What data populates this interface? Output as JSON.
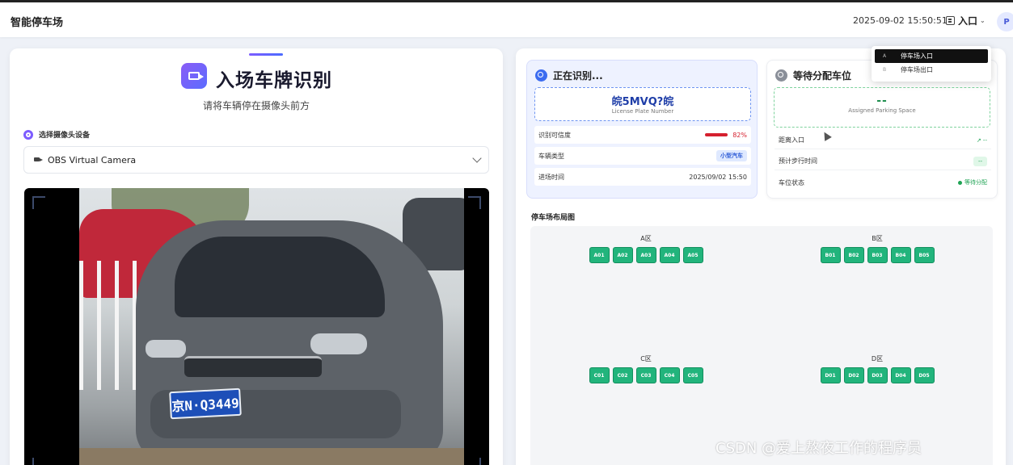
{
  "topbar": {
    "app_title": "智能停车场",
    "clock": "2025-09-02 15:50:51",
    "entry_label": "入口",
    "avatar_letter": "P"
  },
  "dropdown": {
    "items": [
      {
        "key": "A",
        "label": "停车场入口",
        "active": true
      },
      {
        "key": "B",
        "label": "停车场出口",
        "active": false
      }
    ]
  },
  "left": {
    "title": "入场车牌识别",
    "subtitle": "请将车辆停在摄像头前方",
    "camera_label": "选择摄像头设备",
    "camera_selected": "OBS Virtual Camera",
    "plate_in_video": "京N·Q3449"
  },
  "recognition": {
    "title": "正在识别...",
    "plate": "皖5MVQ?皖",
    "plate_caption": "License Plate Number",
    "rows": [
      {
        "label": "识别可信度",
        "value": "82%"
      },
      {
        "label": "车辆类型",
        "value": "小型汽车"
      },
      {
        "label": "进场时间",
        "value": "2025/09/02 15:50"
      }
    ],
    "confidence": 0.82
  },
  "assignment": {
    "title": "等待分配车位",
    "space": "--",
    "space_caption": "Assigned Parking Space",
    "rows": [
      {
        "label": "距离入口",
        "value": "↗ --"
      },
      {
        "label": "预计步行时间",
        "value": "--"
      },
      {
        "label": "车位状态",
        "value": "等待分配"
      }
    ]
  },
  "lot": {
    "title": "停车场布局图",
    "zones": [
      {
        "name": "A区",
        "slots": [
          "A01",
          "A02",
          "A03",
          "A04",
          "A05"
        ]
      },
      {
        "name": "B区",
        "slots": [
          "B01",
          "B02",
          "B03",
          "B04",
          "B05"
        ]
      },
      {
        "name": "C区",
        "slots": [
          "C01",
          "C02",
          "C03",
          "C04",
          "C05"
        ]
      },
      {
        "name": "D区",
        "slots": [
          "D01",
          "D02",
          "D03",
          "D04",
          "D05"
        ]
      }
    ]
  },
  "colors": {
    "accent": "#5b6cff",
    "slot_free": "#22b47c",
    "confidence": "#d5202e"
  },
  "watermark": "CSDN @爱上熬夜工作的程序员"
}
